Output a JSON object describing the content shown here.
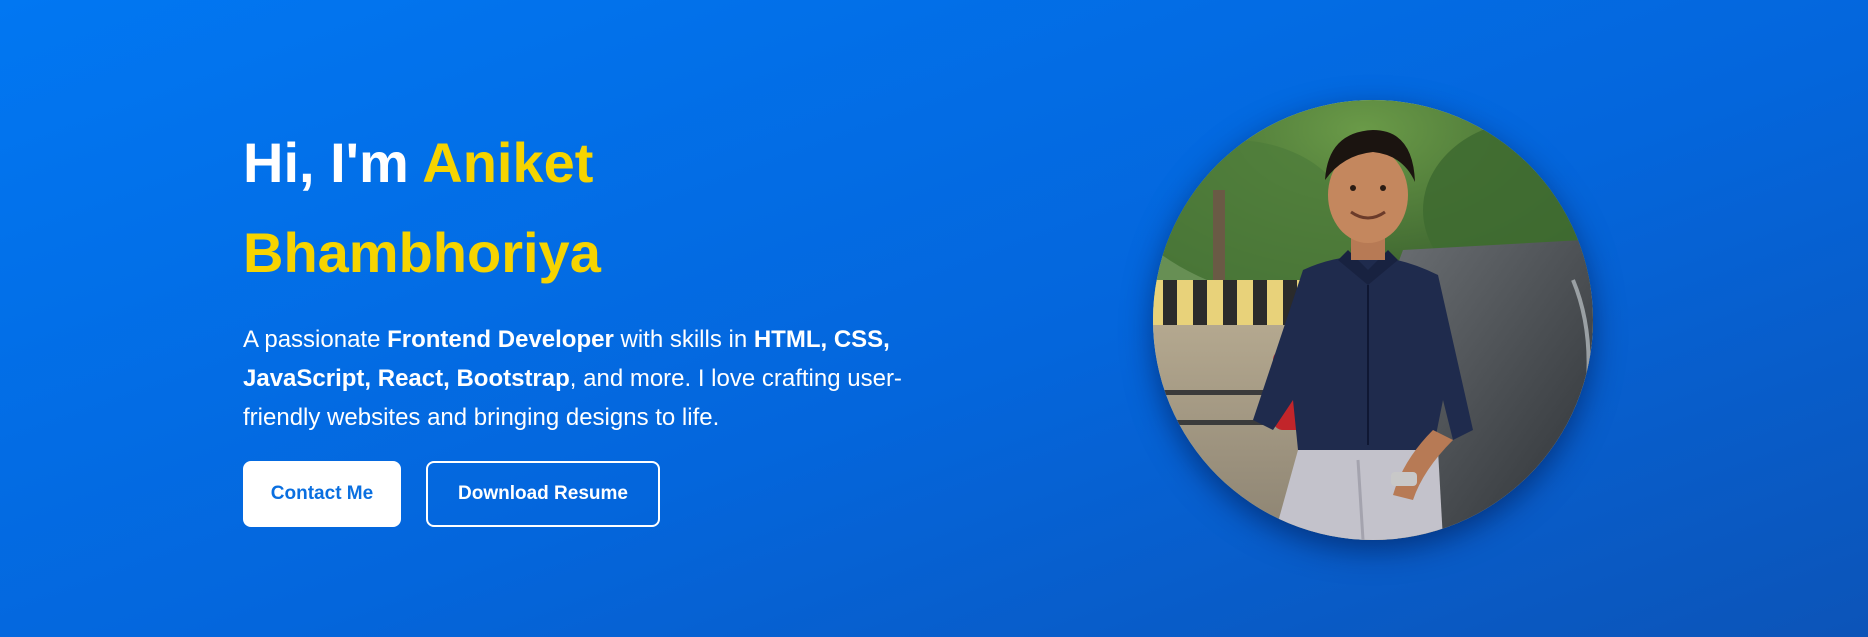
{
  "hero": {
    "greeting": "Hi, I'm ",
    "name_first": "Aniket",
    "name_last": "Bhambhoriya",
    "description": {
      "t1": "A passionate ",
      "b1": "Frontend Developer",
      "t2": " with skills in ",
      "b2": "HTML, CSS, JavaScript, React, Bootstrap",
      "t3": ", and more. I love crafting user-friendly websites and bringing designs to life."
    },
    "contact_label": "Contact Me",
    "resume_label": "Download Resume",
    "photo_icon": "profile-photo"
  },
  "colors": {
    "accent": "#f6d400",
    "primary_blue": "#0477ee",
    "button_text": "#0a6fe0"
  }
}
